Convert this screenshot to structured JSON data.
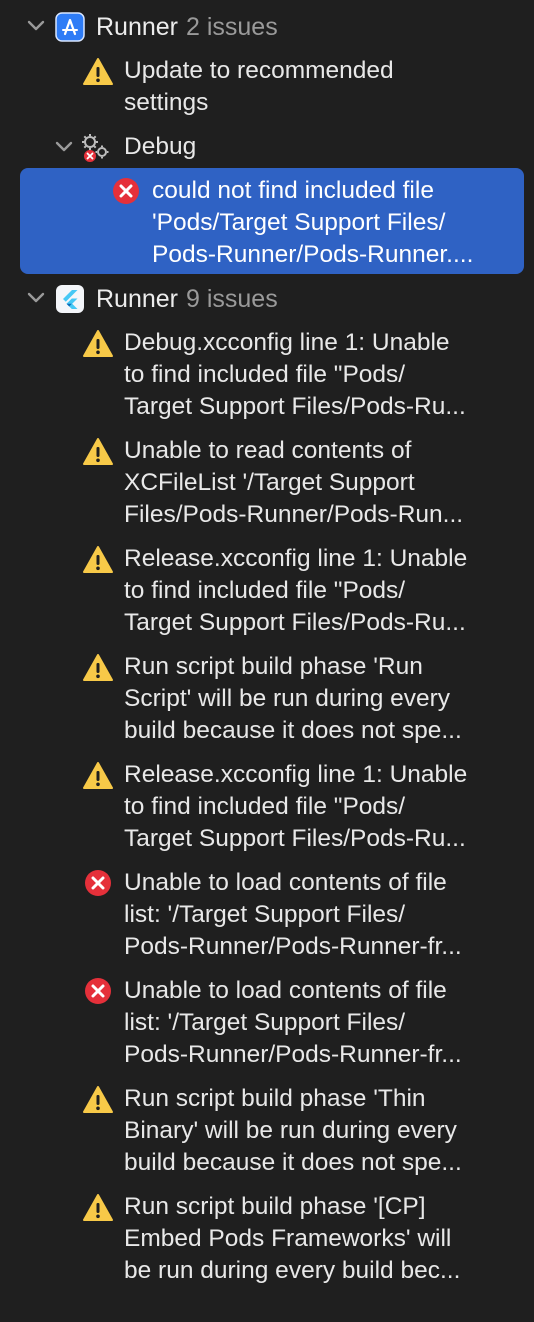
{
  "navigator": {
    "groups": [
      {
        "name": "Runner",
        "count": "2 issues",
        "icon": "xcode-project-icon"
      },
      {
        "name": "Runner",
        "count": "9 issues",
        "icon": "flutter-project-icon"
      }
    ],
    "group1_items": {
      "update": {
        "type": "warning",
        "line1": "Update to recommended",
        "line2": "settings"
      },
      "debug": {
        "label": "Debug",
        "icon": "build-configuration-icon"
      },
      "debug_error": {
        "type": "error",
        "line1": "could not find included file",
        "line2": "'Pods/Target Support Files/",
        "line3": "Pods-Runner/Pods-Runner...."
      }
    },
    "group2_items": [
      {
        "type": "warning",
        "line1": "Debug.xcconfig line 1: Unable",
        "line2": "to find included file \"Pods/",
        "line3": "Target Support Files/Pods-Ru..."
      },
      {
        "type": "warning",
        "line1": "Unable to read contents of",
        "line2": "XCFileList '/Target Support",
        "line3": "Files/Pods-Runner/Pods-Run..."
      },
      {
        "type": "warning",
        "line1": "Release.xcconfig line 1: Unable",
        "line2": "to find included file \"Pods/",
        "line3": "Target Support Files/Pods-Ru..."
      },
      {
        "type": "warning",
        "line1": "Run script build phase 'Run",
        "line2": "Script' will be run during every",
        "line3": "build because it does not spe..."
      },
      {
        "type": "warning",
        "line1": "Release.xcconfig line 1: Unable",
        "line2": "to find included file \"Pods/",
        "line3": "Target Support Files/Pods-Ru..."
      },
      {
        "type": "error",
        "line1": "Unable to load contents of file",
        "line2": "list: '/Target Support Files/",
        "line3": "Pods-Runner/Pods-Runner-fr..."
      },
      {
        "type": "error",
        "line1": "Unable to load contents of file",
        "line2": "list: '/Target Support Files/",
        "line3": "Pods-Runner/Pods-Runner-fr..."
      },
      {
        "type": "warning",
        "line1": "Run script build phase 'Thin",
        "line2": "Binary' will be run during every",
        "line3": "build because it does not spe..."
      },
      {
        "type": "warning",
        "line1": "Run script build phase '[CP]",
        "line2": "Embed Pods Frameworks' will",
        "line3": "be run during every build bec..."
      }
    ]
  },
  "colors": {
    "background": "#1f1f1f",
    "selection": "#2f62c4",
    "warning": "#f7c948",
    "error": "#e5303a"
  }
}
